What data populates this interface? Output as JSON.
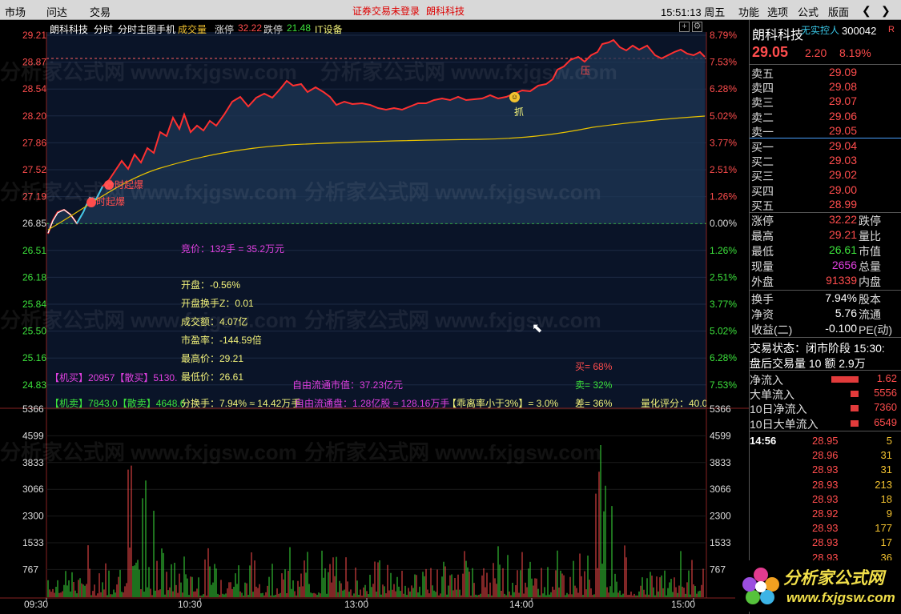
{
  "topbar": {
    "menu": [
      "市场",
      "问达",
      "交易"
    ],
    "login_warning": "证券交易未登录",
    "stock_name": "朗科科技",
    "clock": "15:51:13 周五",
    "right_menu": [
      "功能",
      "选项",
      "公式",
      "版面"
    ],
    "icons": [
      "back-icon",
      "forward-icon"
    ]
  },
  "chart": {
    "header": {
      "name": "朗科科技",
      "mode": "分时",
      "submode": "分时主图手机",
      "ind1": "成交量",
      "limit_up_label": "涨停",
      "limit_up": "32.22",
      "limit_down_label": "跌停",
      "limit_down": "21.48",
      "sector": "IT设备"
    },
    "price_left": [
      "29.21",
      "28.87",
      "28.54",
      "28.20",
      "27.86",
      "27.52",
      "27.19",
      "26.85",
      "26.51",
      "26.18",
      "25.84",
      "25.50",
      "25.16",
      "24.83"
    ],
    "pct_right": [
      "8.79%",
      "7.53%",
      "6.28%",
      "5.02%",
      "3.77%",
      "2.51%",
      "1.26%",
      "0.00%",
      "1.26%",
      "2.51%",
      "3.77%",
      "5.02%",
      "6.28%",
      "7.53%"
    ],
    "vol_axis": [
      "5366",
      "4599",
      "3833",
      "3066",
      "2300",
      "1533",
      "767"
    ],
    "time_axis": [
      "09:30",
      "10:30",
      "13:00",
      "14:00",
      "15:00"
    ],
    "signal1": "分时起爆",
    "signal2": "分时起爆",
    "grab": "抓",
    "pressure": "压",
    "info": {
      "bid": "竞价：132手 = 35.2万元",
      "open": "开盘：-0.56%",
      "open_turnover": "开盘换手Z：0.01",
      "amount": "成交额：4.07亿",
      "pe": "市盈率：-144.59倍",
      "high": "最高价：29.21",
      "low": "最低价：26.61",
      "float_cap": "自由流通市值：37.23亿元",
      "inst_buy": "【机买】20957【散买】5130.",
      "inst_sell": "【机卖】7843.0【散卖】4648.6",
      "turnover": "分换手：7.94% ≈ 14.42万手",
      "float_shares": "自由流通盘：1.28亿股 ≈ 128.16万手",
      "deviation": "【乖离率小于3%】= 3.0%",
      "buy_pct": "买= 68%",
      "sell_pct": "卖= 32%",
      "diff_pct": "差= 36%",
      "quant_score": "量化评分：40.0"
    }
  },
  "panel": {
    "stock_name": "朗科科技",
    "controller": "无实控人",
    "code": "300042",
    "tag": "R",
    "price": "29.05",
    "change": "2.20",
    "change_pct": "8.19%",
    "asks": [
      {
        "label": "卖五",
        "price": "29.09"
      },
      {
        "label": "卖四",
        "price": "29.08"
      },
      {
        "label": "卖三",
        "price": "29.07"
      },
      {
        "label": "卖二",
        "price": "29.06"
      },
      {
        "label": "卖一",
        "price": "29.05"
      }
    ],
    "bids": [
      {
        "label": "买一",
        "price": "29.04"
      },
      {
        "label": "买二",
        "price": "29.03"
      },
      {
        "label": "买三",
        "price": "29.02"
      },
      {
        "label": "买四",
        "price": "29.00"
      },
      {
        "label": "买五",
        "price": "28.99"
      }
    ],
    "stats": [
      {
        "l": "涨停",
        "v": "32.22",
        "x": "跌停",
        "c": "#ff4d4d"
      },
      {
        "l": "最高",
        "v": "29.21",
        "x": "量比",
        "c": "#ff4d4d"
      },
      {
        "l": "最低",
        "v": "26.61",
        "x": "市值",
        "c": "#3ce23c"
      },
      {
        "l": "现量",
        "v": "2656",
        "x": "总量",
        "c": "#e040e0"
      },
      {
        "l": "外盘",
        "v": "91339",
        "x": "内盘",
        "c": "#ff4d4d"
      }
    ],
    "stats2": [
      {
        "l": "换手",
        "v": "7.94%",
        "x": "股本",
        "c": "#ffffff"
      },
      {
        "l": "净资",
        "v": "5.76",
        "x": "流通",
        "c": "#ffffff"
      },
      {
        "l": "收益(二)",
        "v": "-0.100",
        "x": "PE(动)",
        "c": "#ffffff"
      }
    ],
    "trade_status": "交易状态：闭市阶段 15:30:",
    "after_hours": "盘后交易量 10 额 2.9万",
    "flows": [
      {
        "l": "净流入",
        "v": "1.62"
      },
      {
        "l": "大单流入",
        "v": "5556"
      },
      {
        "l": "10日净流入",
        "v": "7360"
      },
      {
        "l": "10日大单流入",
        "v": "6549"
      }
    ],
    "ticks": [
      {
        "t": "14:56",
        "p": "28.95",
        "q": "5"
      },
      {
        "t": "",
        "p": "28.96",
        "q": "31"
      },
      {
        "t": "",
        "p": "28.93",
        "q": "31"
      },
      {
        "t": "",
        "p": "28.93",
        "q": "213"
      },
      {
        "t": "",
        "p": "28.93",
        "q": "18"
      },
      {
        "t": "",
        "p": "28.92",
        "q": "9"
      },
      {
        "t": "",
        "p": "28.93",
        "q": "177"
      },
      {
        "t": "",
        "p": "28.93",
        "q": "17"
      },
      {
        "t": "",
        "p": "28.93",
        "q": "36"
      }
    ]
  },
  "logo": {
    "name": "分析家公式网",
    "url": "www.fxjgsw.com"
  },
  "watermark": "分析家公式网 www.fxjgsw.com",
  "colors": {
    "up": "#ff4d4d",
    "down": "#3ce23c",
    "avg": "#e6c000",
    "magenta": "#e040e0",
    "yellow": "#f2f27a"
  }
}
